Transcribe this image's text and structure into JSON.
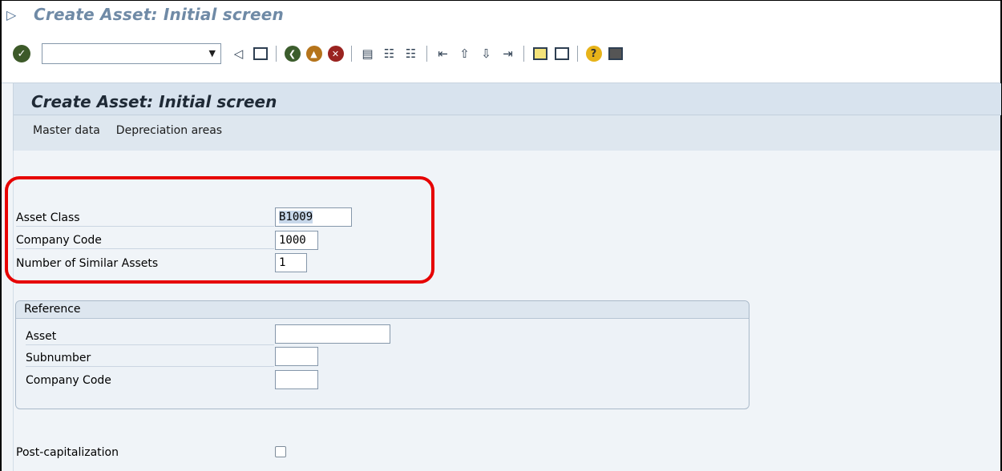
{
  "window": {
    "title": "Create Asset:  Initial screen"
  },
  "toolbar": {
    "command_field_value": "",
    "icons": [
      "enter-icon",
      "back-icon",
      "save-icon",
      "back-green-icon",
      "exit-icon",
      "cancel-icon",
      "print-icon",
      "find-icon",
      "find-next-icon",
      "first-page-icon",
      "previous-page-icon",
      "next-page-icon",
      "last-page-icon",
      "create-session-icon",
      "shortcut-icon",
      "help-icon",
      "layout-icon"
    ]
  },
  "screen": {
    "title": "Create Asset:  Initial screen",
    "menu": [
      "Master data",
      "Depreciation areas"
    ]
  },
  "fields": {
    "asset_class": {
      "label": "Asset Class",
      "value": "B1009"
    },
    "company_code": {
      "label": "Company Code",
      "value": "1000"
    },
    "similar_assets": {
      "label": "Number of Similar Assets",
      "value": "1"
    }
  },
  "reference": {
    "title": "Reference",
    "asset": {
      "label": "Asset",
      "value": ""
    },
    "subnumber": {
      "label": "Subnumber",
      "value": ""
    },
    "company_code": {
      "label": "Company Code",
      "value": ""
    }
  },
  "post_capitalization": {
    "label": "Post-capitalization",
    "checked": false
  },
  "colors": {
    "highlight": "#e60000",
    "background": "#f0f4f8",
    "header": "#dee7ef"
  }
}
